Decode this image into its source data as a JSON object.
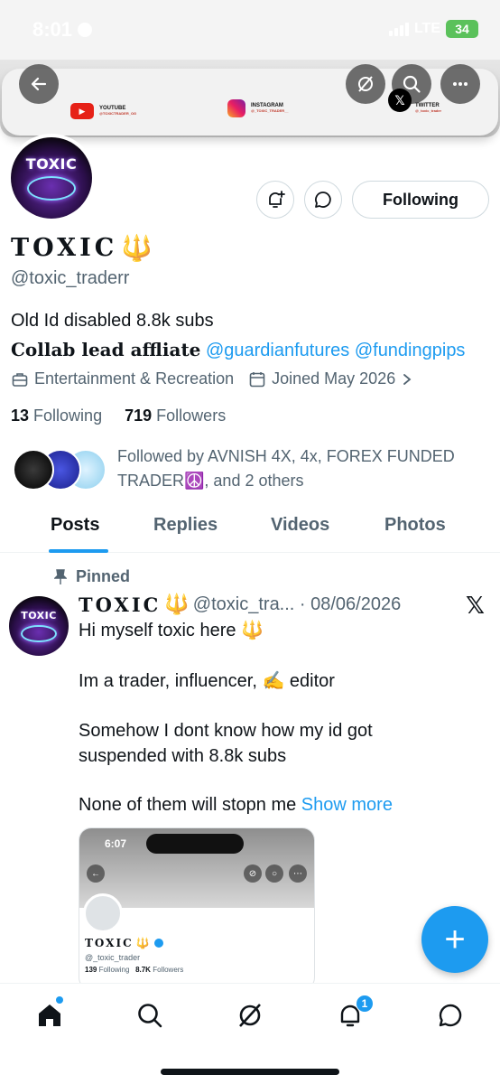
{
  "status_bar": {
    "time": "8:01",
    "network": "LTE",
    "battery": "34"
  },
  "banner": {
    "youtube_label": "YOUTUBE",
    "youtube_handle": "@TOXICTRADER_OG",
    "instagram_label": "INSTAGRAM",
    "instagram_handle": "@_TOXIC_TRADER__",
    "twitter_label": "TWITTER",
    "twitter_handle": "@_toxic_trader"
  },
  "avatar": {
    "logo_text": "TOXIC"
  },
  "profile": {
    "name": "TOXIC",
    "name_emoji": "🔱",
    "handle": "@toxic_traderr",
    "follow_button": "Following",
    "bio_line1": "Old Id disabled 8.8k subs",
    "bio_line2_prefix": "Collab lead affliate",
    "bio_link1": "@guardianfutures",
    "bio_link2": "@fundingpips",
    "category": "Entertainment & Recreation",
    "joined": "Joined May 2026",
    "following_count": "13",
    "following_label": "Following",
    "followers_count": "719",
    "followers_label": "Followers",
    "followed_by_line1": "Followed by AVNISH 4X, 4x, FOREX FUNDED",
    "followed_by_line2": "TRADER☮️, and 2 others"
  },
  "tabs": [
    "Posts",
    "Replies",
    "Videos",
    "Photos"
  ],
  "post": {
    "pinned_label": "Pinned",
    "author_name": "TOXIC",
    "author_emoji": "🔱",
    "handle_date": "@toxic_tra... · 08/06/2026",
    "lines": [
      "Hi myself toxic here 🔱",
      "Im a trader, influencer, ✍️ editor",
      "Somehow I dont know how my id got",
      "suspended with 8.8k subs",
      "None of them will stopn me"
    ],
    "show_more": "Show more"
  },
  "embedded_screenshot": {
    "time": "6:07",
    "name": "TOXIC",
    "handle": "@_toxic_trader",
    "following_count": "139",
    "following_label": "Following",
    "followers_count": "8.7K",
    "followers_label": "Followers"
  },
  "fab": {
    "label": "+"
  },
  "bottom_nav": {
    "notifications_badge": "1"
  },
  "colors": {
    "accent": "#1d9bf0",
    "text": "#0f1419",
    "muted": "#536471",
    "border": "#cfd9de"
  }
}
